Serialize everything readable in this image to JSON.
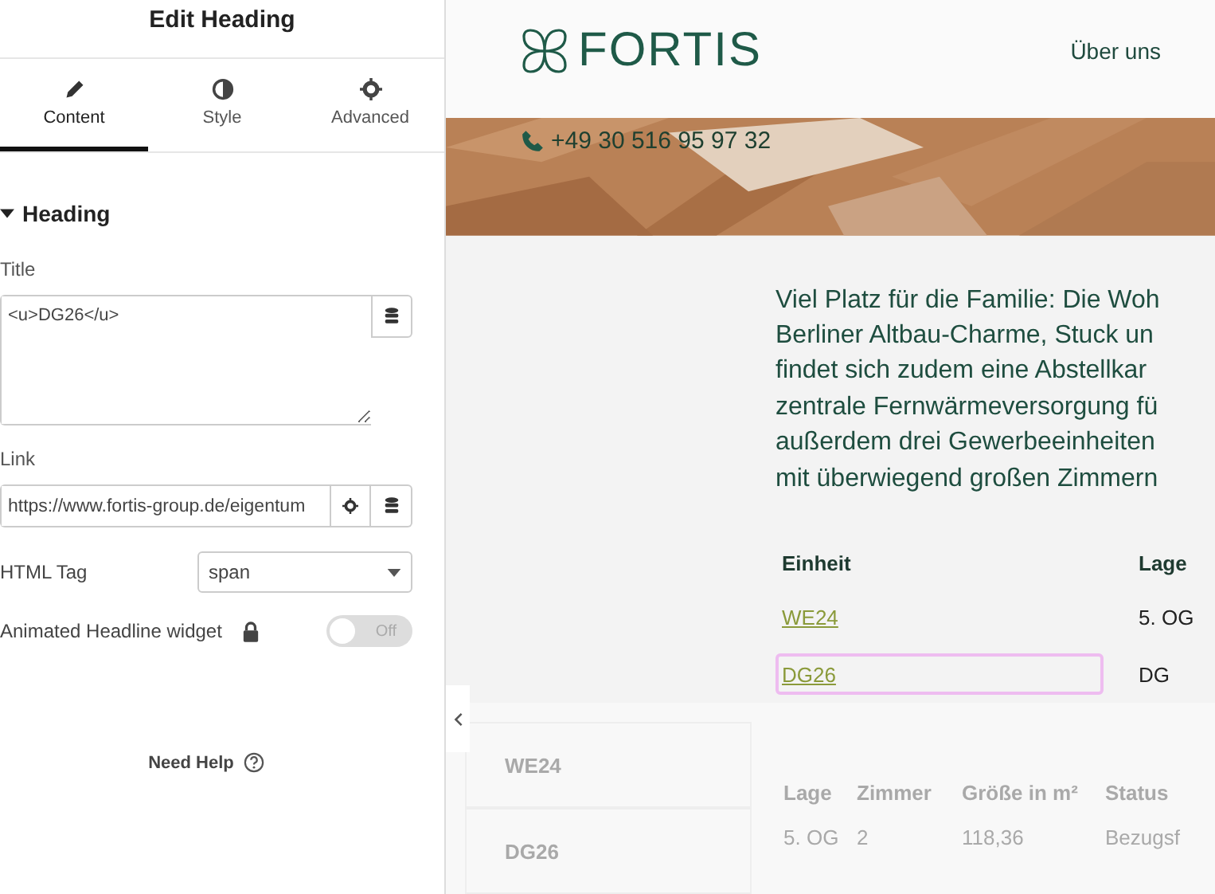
{
  "panel": {
    "title": "Edit Heading",
    "tabs": [
      {
        "label": "Content",
        "selected": true
      },
      {
        "label": "Style",
        "selected": false
      },
      {
        "label": "Advanced",
        "selected": false
      }
    ],
    "section": {
      "label": "Heading",
      "expanded": true
    },
    "title_field": {
      "label": "Title",
      "value": "<u>DG26</u>"
    },
    "link_field": {
      "label": "Link",
      "value": "https://www.fortis-group.de/eigentum"
    },
    "html_tag": {
      "label": "HTML Tag",
      "value": "span"
    },
    "animated": {
      "label": "Animated Headline widget",
      "locked": true,
      "on": false,
      "state_label": "Off"
    },
    "help": "Need Help"
  },
  "preview": {
    "logo": "FORTIS",
    "nav": [
      "Über uns"
    ],
    "phone": "+49 30 516 95 97 32",
    "paragraph": [
      "Viel Platz für die Familie: Die Woh",
      "Berliner Altbau-Charme, Stuck un",
      "findet sich zudem eine Abstellkar",
      "zentrale Fernwärmeversorgung fü",
      "außerdem drei Gewerbeeinheiten",
      "mit überwiegend großen Zimmern"
    ],
    "table": {
      "columns": [
        "Einheit",
        "Lage"
      ],
      "rows": [
        {
          "unit": "WE24",
          "floor": "5. OG",
          "selected": false
        },
        {
          "unit": "DG26",
          "floor": "DG",
          "selected": true
        }
      ]
    },
    "faded": {
      "cards": [
        "WE24",
        "DG26"
      ],
      "columns": [
        "Lage",
        "Zimmer",
        "Größe in m²",
        "Status"
      ],
      "row": [
        "5. OG",
        "2",
        "118,36",
        "Bezugsf"
      ]
    }
  }
}
